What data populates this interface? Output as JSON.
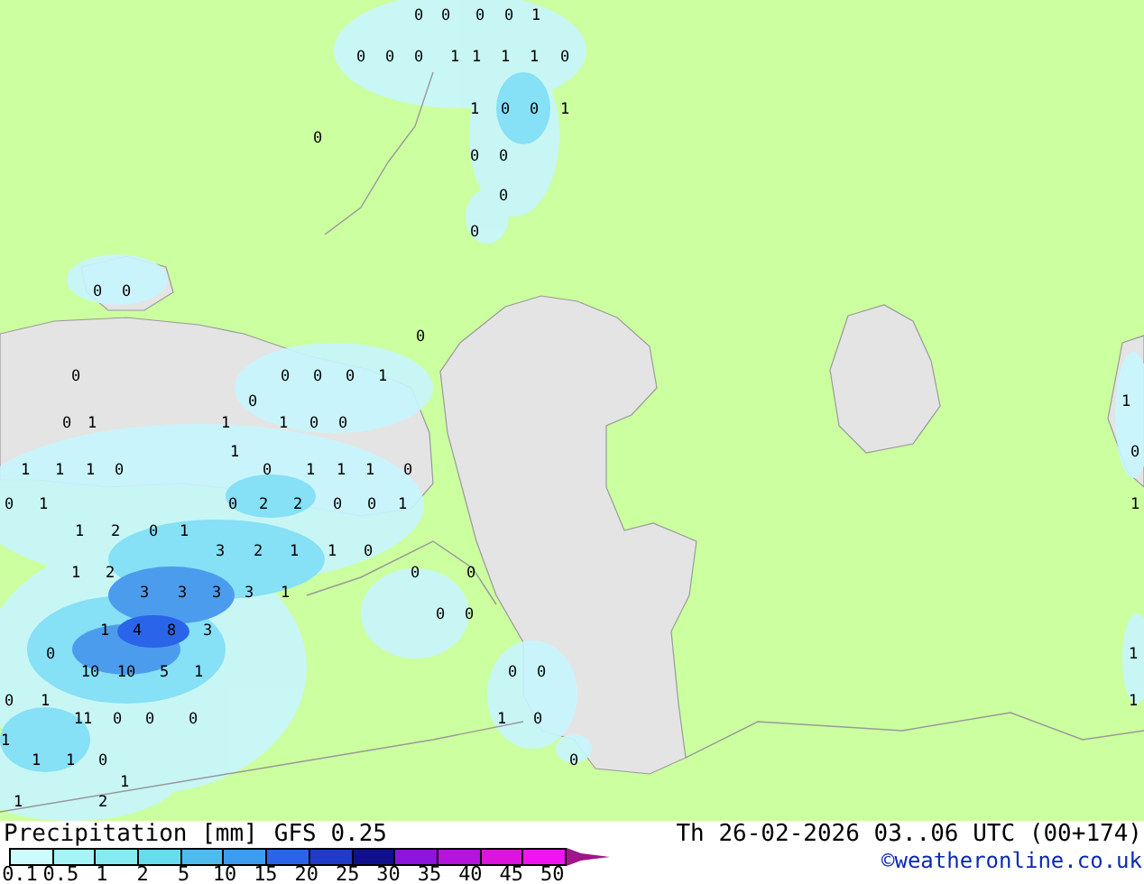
{
  "map": {
    "labels": [
      "0",
      "0",
      "0",
      "0",
      "1",
      "0",
      "0",
      "0",
      "1",
      "1",
      "1",
      "1",
      "0",
      "1",
      "0",
      "0",
      "1",
      "0",
      "0",
      "0",
      "0",
      "0",
      "0",
      "0",
      "0",
      "0",
      "0",
      "0",
      "0",
      "1",
      "0",
      "1",
      "0",
      "1",
      "1",
      "1",
      "0",
      "0",
      "1",
      "0",
      "1",
      "1",
      "1",
      "0",
      "0",
      "1",
      "1",
      "1",
      "0",
      "0",
      "1",
      "0",
      "2",
      "2",
      "0",
      "0",
      "1",
      "1",
      "1",
      "2",
      "0",
      "1",
      "3",
      "2",
      "1",
      "1",
      "0",
      "1",
      "2",
      "0",
      "0",
      "3",
      "3",
      "3",
      "3",
      "1",
      "0",
      "0",
      "1",
      "4",
      "8",
      "3",
      "0",
      "1",
      "10",
      "10",
      "5",
      "1",
      "0",
      "0",
      "0",
      "1",
      "1",
      "11",
      "0",
      "0",
      "0",
      "1",
      "0",
      "1",
      "1",
      "1",
      "0",
      "0",
      "1",
      "1",
      "2"
    ]
  },
  "legend": {
    "title": "Precipitation [mm]",
    "model": "GFS 0.25",
    "valid_time": "Th 26-02-2026 03..06 UTC (00+174)",
    "credit": "©weatheronline.co.uk",
    "segments": [
      {
        "kind": "box",
        "color": "#cdfcfc"
      },
      {
        "kind": "box",
        "color": "#a6f4f6"
      },
      {
        "kind": "box",
        "color": "#86ecf2"
      },
      {
        "kind": "box",
        "color": "#66dcee"
      },
      {
        "kind": "box",
        "color": "#50bcee"
      },
      {
        "kind": "box",
        "color": "#3c9cf0"
      },
      {
        "kind": "box",
        "color": "#2a64e8"
      },
      {
        "kind": "box",
        "color": "#1e3cc8"
      },
      {
        "kind": "box",
        "color": "#10108c"
      },
      {
        "kind": "box",
        "color": "#8c14dc"
      },
      {
        "kind": "box",
        "color": "#b414dc"
      },
      {
        "kind": "box",
        "color": "#dc14dc"
      },
      {
        "kind": "box",
        "color": "#f014f0"
      },
      {
        "kind": "arrow",
        "color": "#a0148c"
      }
    ],
    "ticks": [
      "0.1",
      "0.5",
      "1",
      "2",
      "5",
      "10",
      "15",
      "20",
      "25",
      "30",
      "35",
      "40",
      "45",
      "50"
    ]
  }
}
